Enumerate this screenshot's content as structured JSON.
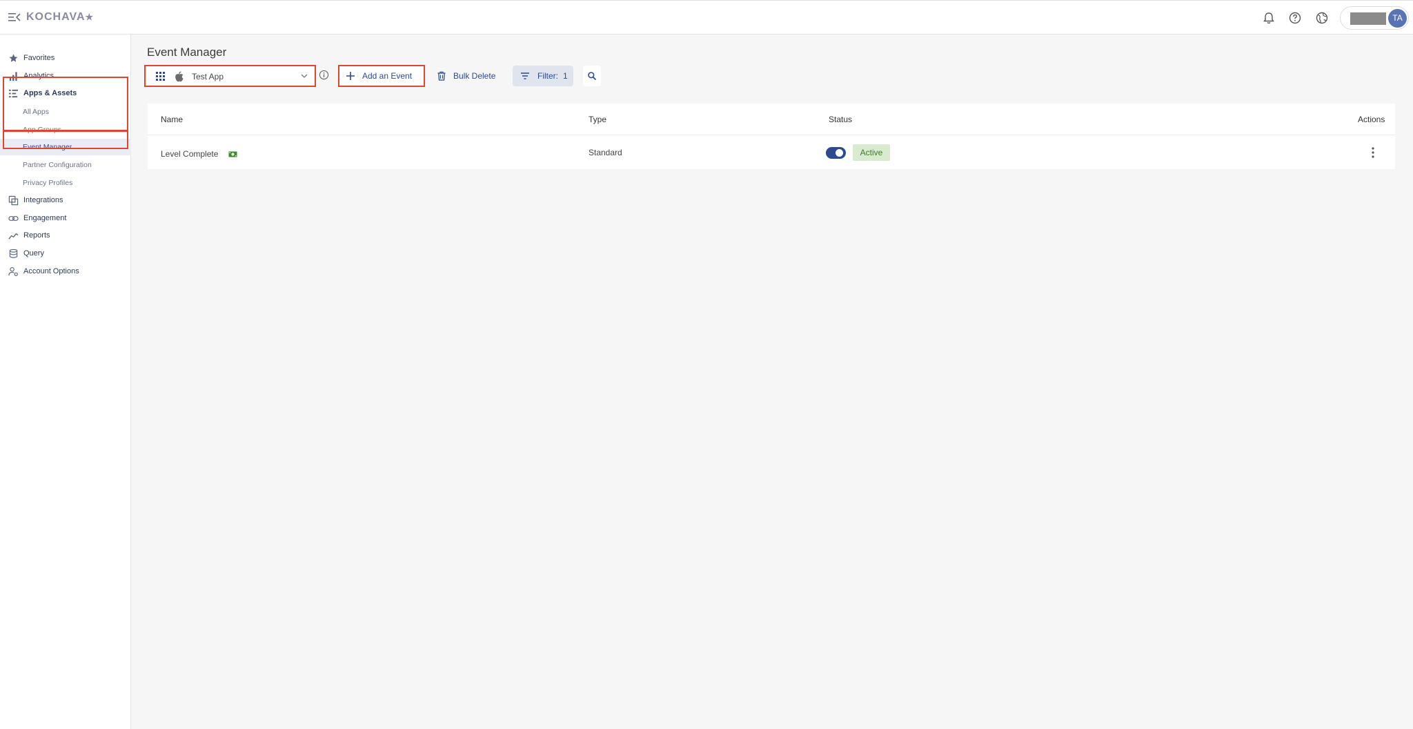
{
  "brand": {
    "name": "KOCHAVA",
    "star": "★"
  },
  "header": {
    "icons": [
      "bell-icon",
      "help-icon",
      "globe-icon"
    ],
    "avatar_initials": "TA"
  },
  "sidebar": {
    "items": [
      {
        "label": "Favorites",
        "icon": "star-icon"
      },
      {
        "label": "Analytics",
        "icon": "bar-chart-icon"
      },
      {
        "label": "Apps & Assets",
        "icon": "list-icon"
      },
      {
        "label": "Integrations",
        "icon": "copy-icon"
      },
      {
        "label": "Engagement",
        "icon": "link-icon"
      },
      {
        "label": "Reports",
        "icon": "trend-icon"
      },
      {
        "label": "Query",
        "icon": "database-icon"
      },
      {
        "label": "Account Options",
        "icon": "account-settings-icon"
      }
    ],
    "subitems": [
      {
        "label": "All Apps",
        "active": false
      },
      {
        "label": "App Groups",
        "active": false
      },
      {
        "label": "Event Manager",
        "active": true
      },
      {
        "label": "Partner Configuration",
        "active": false
      },
      {
        "label": "Privacy Profiles",
        "active": false
      }
    ]
  },
  "main": {
    "title": "Event Manager",
    "app_selector": {
      "value": "Test App",
      "platform_icon": "apple-icon"
    },
    "toolbar": {
      "add_label": "Add an Event",
      "bulk_delete_label": "Bulk Delete",
      "filter_label": "Filter:",
      "filter_count": "1"
    },
    "table": {
      "columns": [
        "Name",
        "Type",
        "Status",
        "Actions"
      ],
      "rows": [
        {
          "name": "Level Complete",
          "name_icon": "cash-icon",
          "type": "Standard",
          "enabled": true,
          "status": "Active"
        }
      ]
    }
  },
  "colors": {
    "accent": "#2b4a8f",
    "highlight_border": "#e0452d",
    "status_active_bg": "#d8ebcf",
    "status_active_text": "#3d7a25"
  }
}
